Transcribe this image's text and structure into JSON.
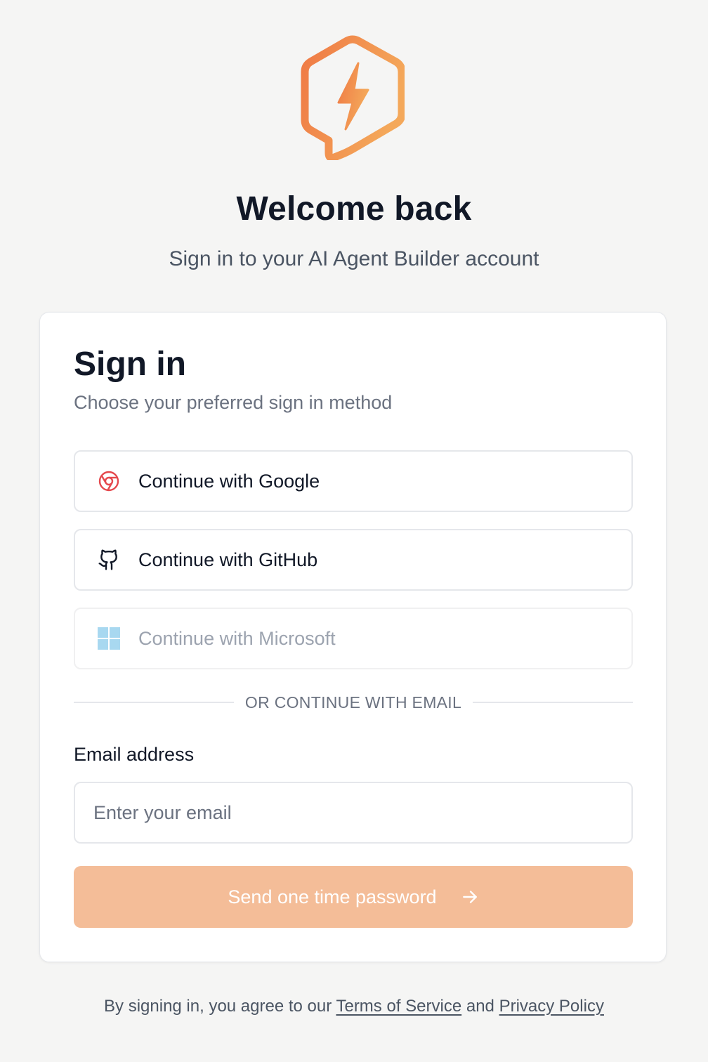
{
  "brand": {
    "logo_icon": "lightning-bolt-chat-icon",
    "accent_gradient": [
      "#ef7a45",
      "#f4a85a"
    ]
  },
  "header": {
    "title": "Welcome back",
    "subtitle": "Sign in to your AI Agent Builder account"
  },
  "card": {
    "title": "Sign in",
    "subtitle": "Choose your preferred sign in method",
    "oauth": [
      {
        "provider": "google",
        "label": "Continue with Google",
        "icon": "chrome-icon",
        "enabled": true
      },
      {
        "provider": "github",
        "label": "Continue with GitHub",
        "icon": "github-icon",
        "enabled": true
      },
      {
        "provider": "microsoft",
        "label": "Continue with Microsoft",
        "icon": "windows-icon",
        "enabled": false
      }
    ],
    "divider": "OR CONTINUE WITH EMAIL",
    "email": {
      "label": "Email address",
      "placeholder": "Enter your email",
      "value": ""
    },
    "submit_label": "Send one time password",
    "submit_icon": "arrow-right-icon",
    "submit_color": "#f4bd98"
  },
  "footer": {
    "prefix": "By signing in, you agree to our ",
    "terms": "Terms of Service",
    "and": " and ",
    "privacy": "Privacy Policy"
  }
}
